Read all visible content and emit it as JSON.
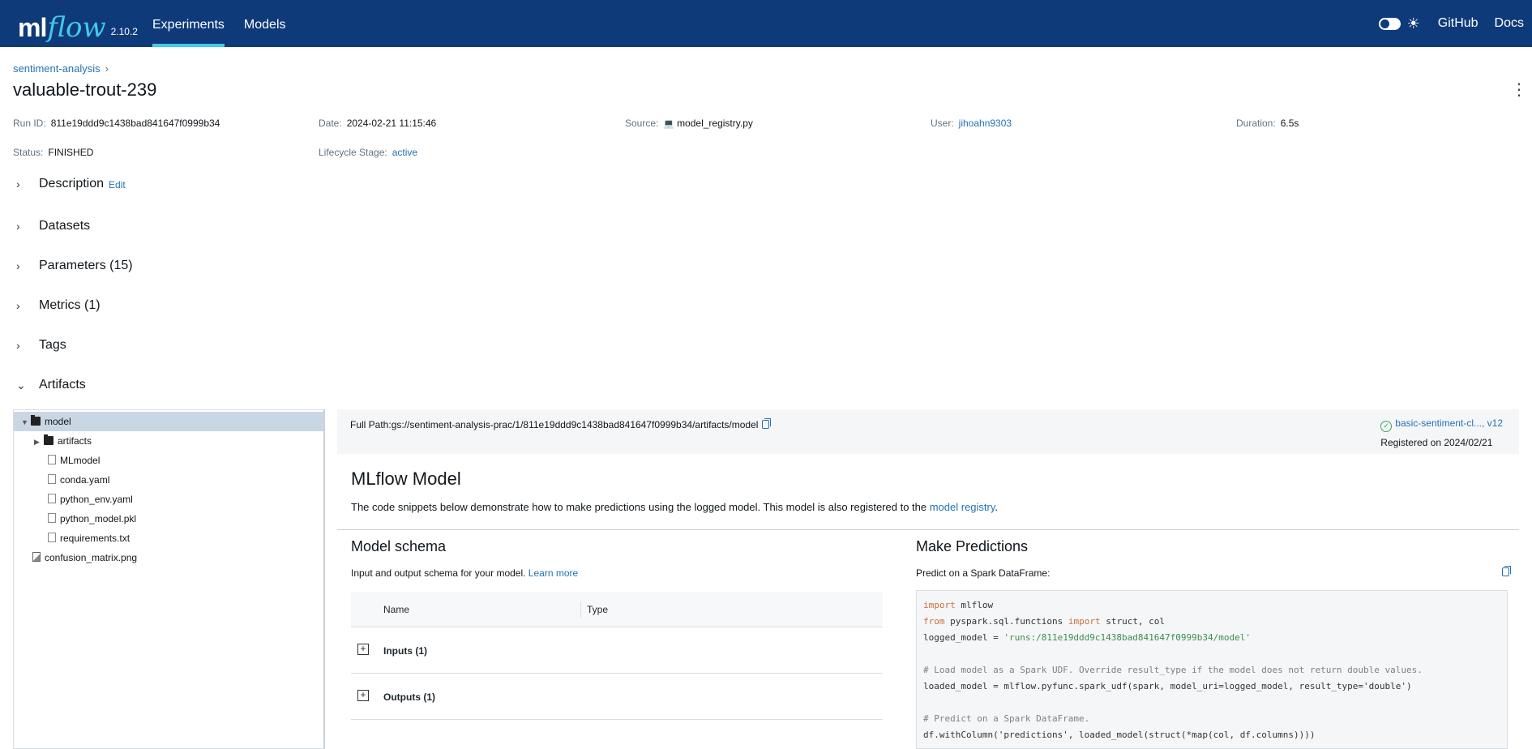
{
  "header": {
    "logo_ml": "ml",
    "logo_flow": "flow",
    "version": "2.10.2",
    "nav": [
      "Experiments",
      "Models"
    ],
    "links": [
      "GitHub",
      "Docs"
    ]
  },
  "breadcrumb": "sentiment-analysis",
  "run_name": "valuable-trout-239",
  "meta": {
    "run_id_label": "Run ID:",
    "run_id": "811e19ddd9c1438bad841647f0999b34",
    "date_label": "Date:",
    "date": "2024-02-21 11:15:46",
    "source_label": "Source:",
    "source": "model_registry.py",
    "user_label": "User:",
    "user": "jihoahn9303",
    "duration_label": "Duration:",
    "duration": "6.5s",
    "status_label": "Status:",
    "status": "FINISHED",
    "lifecycle_label": "Lifecycle Stage:",
    "lifecycle": "active"
  },
  "sections": {
    "description": "Description",
    "edit": "Edit",
    "datasets": "Datasets",
    "parameters": "Parameters (15)",
    "metrics": "Metrics (1)",
    "tags": "Tags",
    "artifacts": "Artifacts"
  },
  "tree": {
    "model": "model",
    "artifacts": "artifacts",
    "files": [
      "MLmodel",
      "conda.yaml",
      "python_env.yaml",
      "python_model.pkl",
      "requirements.txt"
    ],
    "confusion": "confusion_matrix.png"
  },
  "artifact": {
    "full_path": "Full Path:gs://sentiment-analysis-prac/1/811e19ddd9c1438bad841647f0999b34/artifacts/model",
    "registered_link": "basic-sentiment-cl..., v12",
    "registered_on": "Registered on 2024/02/21",
    "title": "MLflow Model",
    "desc_text": "The code snippets below demonstrate how to make predictions using the logged model. This model is also registered to the ",
    "desc_link": "model registry",
    "desc_end": "."
  },
  "schema": {
    "title": "Model schema",
    "desc": "Input and output schema for your model. ",
    "learn_more": "Learn more",
    "col_name": "Name",
    "col_type": "Type",
    "inputs": "Inputs (1)",
    "outputs": "Outputs (1)"
  },
  "predict": {
    "title": "Make Predictions",
    "desc": "Predict on a Spark DataFrame:",
    "code": {
      "l1_kw": "import",
      "l1_rest": " mlflow",
      "l2_kw1": "from",
      "l2_mid": " pyspark.sql.functions ",
      "l2_kw2": "import",
      "l2_rest": " struct, col",
      "l3_a": "logged_model = ",
      "l3_str": "'runs:/811e19ddd9c1438bad841647f0999b34/model'",
      "l5": "# Load model as a Spark UDF. Override result_type if the model does not return double values.",
      "l6": "loaded_model = mlflow.pyfunc.spark_udf(spark, model_uri=logged_model, result_type='double')",
      "l8": "# Predict on a Spark DataFrame.",
      "l9": "df.withColumn('predictions', loaded_model(struct(*map(col, df.columns))))"
    }
  }
}
